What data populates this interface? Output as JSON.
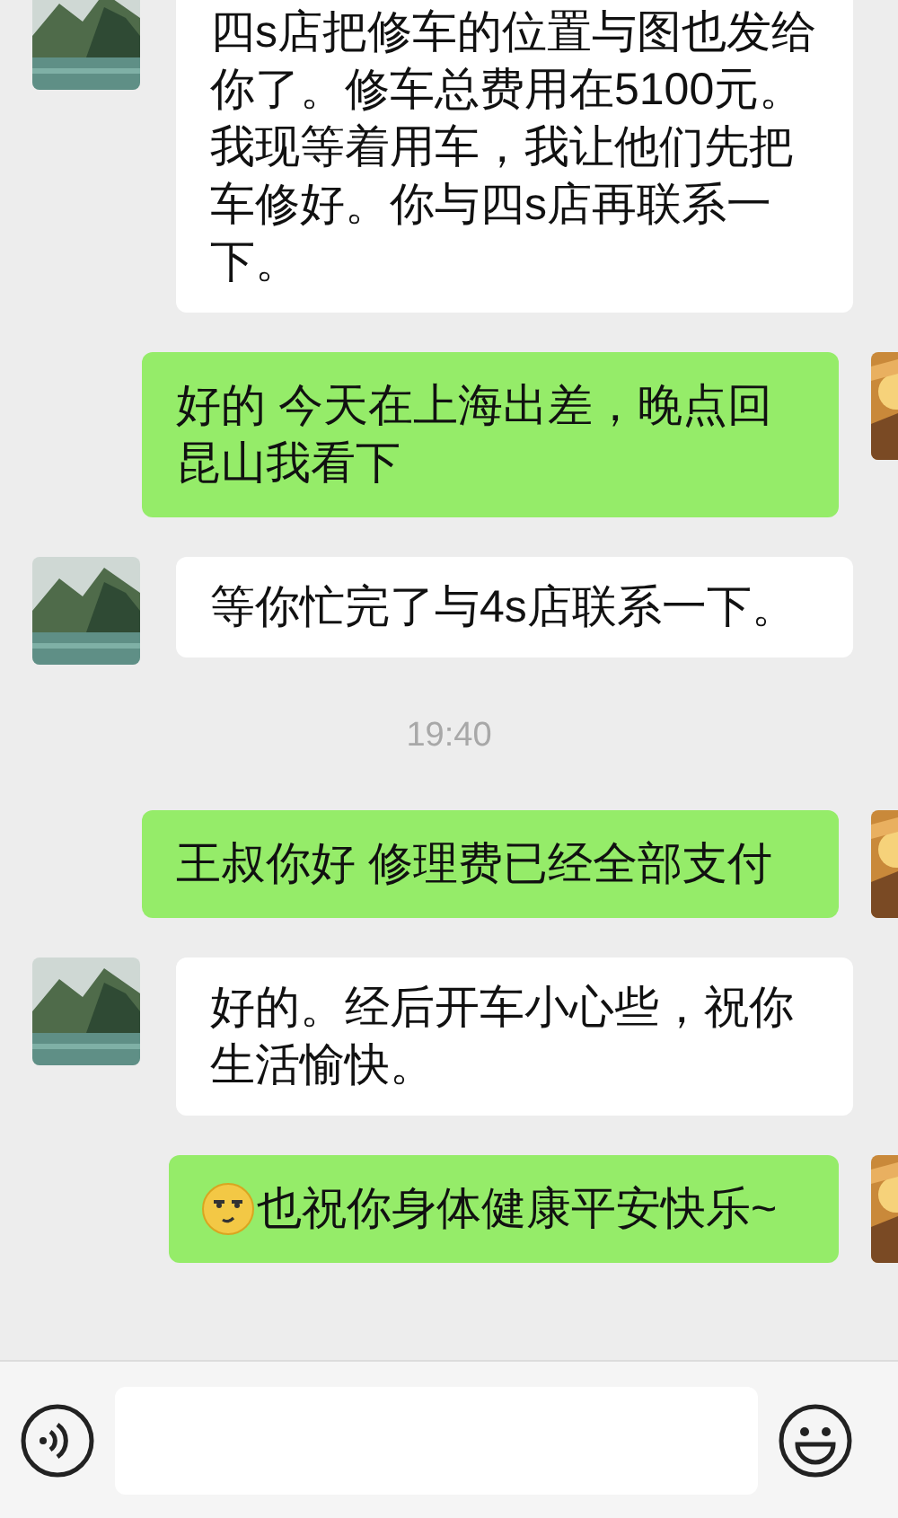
{
  "messages": [
    {
      "kind": "incoming",
      "text": "四s店把修车的位置与图也发给你了。修车总费用在5100元。我现等着用车，我让他们先把车修好。你与四s店再联系一下。"
    },
    {
      "kind": "outgoing",
      "text": "好的  今天在上海出差，晚点回昆山我看下"
    },
    {
      "kind": "incoming",
      "text": "等你忙完了与4s店联系一下。"
    },
    {
      "kind": "timestamp",
      "text": "19:40"
    },
    {
      "kind": "outgoing",
      "text": "王叔你好  修理费已经全部支付"
    },
    {
      "kind": "incoming",
      "text": "好的。经后开车小心些，祝你生活愉快。"
    },
    {
      "kind": "outgoing_emoji",
      "text": "也祝你身体健康平安快乐~"
    }
  ]
}
